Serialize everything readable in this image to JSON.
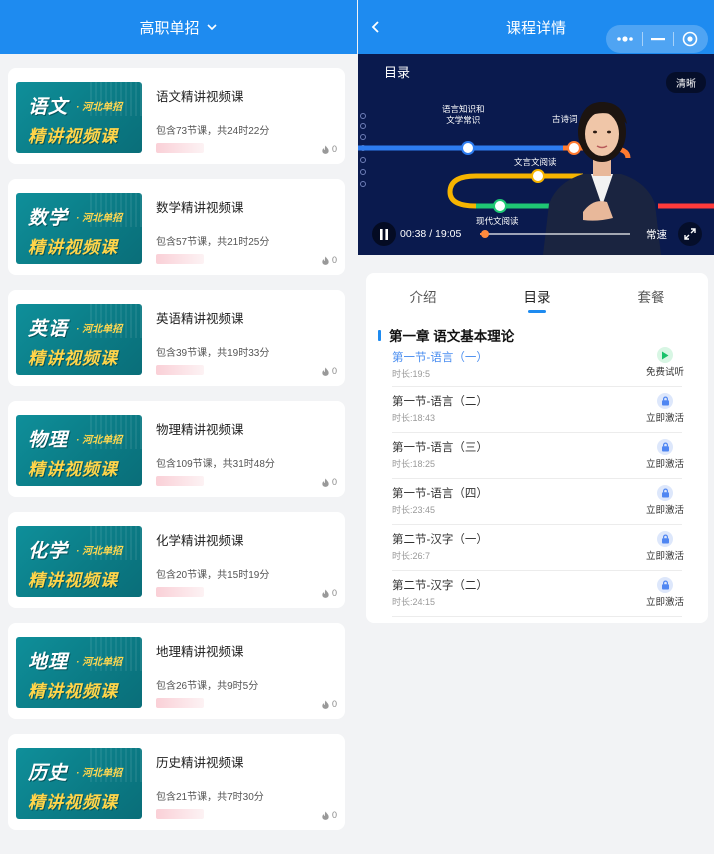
{
  "left": {
    "header": {
      "title": "高职单招"
    },
    "courses": [
      {
        "subject": "语文",
        "region": "· 河北单招",
        "tag": "精讲视频课",
        "title": "语文精讲视频课",
        "meta": "包含73节课，共24时22分",
        "likes": "0"
      },
      {
        "subject": "数学",
        "region": "· 河北单招",
        "tag": "精讲视频课",
        "title": "数学精讲视频课",
        "meta": "包含57节课，共21时25分",
        "likes": "0"
      },
      {
        "subject": "英语",
        "region": "· 河北单招",
        "tag": "精讲视频课",
        "title": "英语精讲视频课",
        "meta": "包含39节课，共19时33分",
        "likes": "0"
      },
      {
        "subject": "物理",
        "region": "· 河北单招",
        "tag": "精讲视频课",
        "title": "物理精讲视频课",
        "meta": "包含109节课，共31时48分",
        "likes": "0"
      },
      {
        "subject": "化学",
        "region": "· 河北单招",
        "tag": "精讲视频课",
        "title": "化学精讲视频课",
        "meta": "包含20节课，共15时19分",
        "likes": "0"
      },
      {
        "subject": "地理",
        "region": "· 河北单招",
        "tag": "精讲视频课",
        "title": "地理精讲视频课",
        "meta": "包含26节课，共9时5分",
        "likes": "0"
      },
      {
        "subject": "历史",
        "region": "· 河北单招",
        "tag": "精讲视频课",
        "title": "历史精讲视频课",
        "meta": "包含21节课，共7时30分",
        "likes": "0"
      }
    ]
  },
  "right": {
    "header": {
      "title": "课程详情"
    },
    "video": {
      "slide_title": "目录",
      "clarity_top": "清晰",
      "labels": {
        "l1": "语言知识和\n文学常识",
        "l2": "古诗词",
        "l3": "文言文阅读",
        "l4": "现代文阅读"
      },
      "time": "00:38 / 19:05",
      "progress": 0.033,
      "clarity_bottom": "常速"
    },
    "tabs": [
      "介绍",
      "目录",
      "套餐"
    ],
    "active_tab": 1,
    "chapter": "第一章 语文基本理论",
    "lessons": [
      {
        "name": "第一节-语言（一）",
        "duration": "时长:19:5",
        "action": "免费试听",
        "type": "free"
      },
      {
        "name": "第一节-语言（二）",
        "duration": "时长:18:43",
        "action": "立即激活",
        "type": "locked"
      },
      {
        "name": "第一节-语言（三）",
        "duration": "时长:18:25",
        "action": "立即激活",
        "type": "locked"
      },
      {
        "name": "第一节-语言（四）",
        "duration": "时长:23:45",
        "action": "立即激活",
        "type": "locked"
      },
      {
        "name": "第二节-汉字（一）",
        "duration": "时长:26:7",
        "action": "立即激活",
        "type": "locked"
      },
      {
        "name": "第二节-汉字（二）",
        "duration": "时长:24:15",
        "action": "立即激活",
        "type": "locked"
      }
    ]
  },
  "colors": {
    "primary": "#1e8bf0",
    "thumb_bg": "#0f8f9a",
    "thumb_accent": "#ffd54a",
    "video_bg": "#0a1a4e",
    "progress": "#ff8a3d"
  },
  "icons": {
    "header_chevron": "chevron-down-icon",
    "back": "back-arrow-icon",
    "capsule": [
      "more-dots-icon",
      "minimize-icon",
      "close-target-icon"
    ],
    "like": "flame-icon",
    "play": "pause-icon",
    "fullscreen": "fullscreen-icon",
    "free": "play-icon",
    "locked": "lock-icon"
  }
}
